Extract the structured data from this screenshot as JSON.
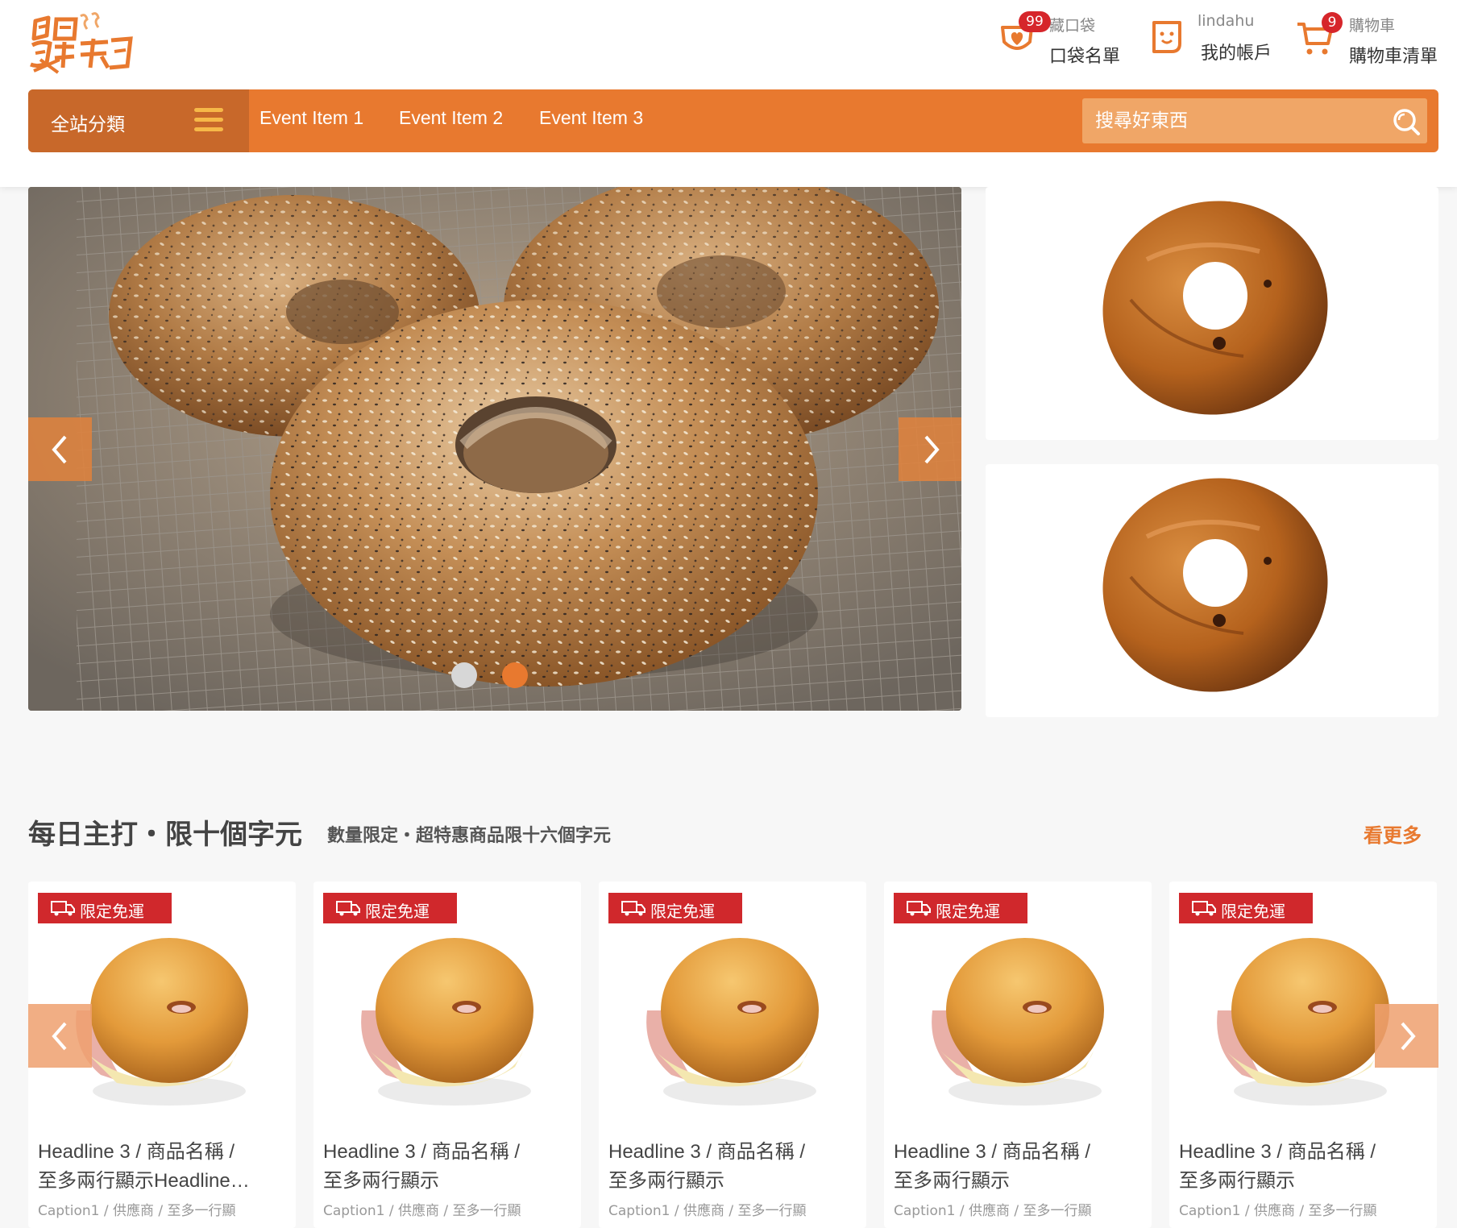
{
  "brand": {
    "logo_text": "食尚玩家"
  },
  "header": {
    "pocket": {
      "count": "99",
      "small_label": "藏口袋",
      "big_label": "口袋名單"
    },
    "account": {
      "username": "lindahu",
      "big_label": "我的帳戶"
    },
    "cart": {
      "count": "9",
      "small_label": "購物車",
      "big_label": "購物車清單"
    }
  },
  "nav": {
    "category_label": "全站分類",
    "events": [
      "Event Item 1",
      "Event Item 2",
      "Event Item 3"
    ],
    "search_placeholder": "搜尋好東西"
  },
  "carousel": {
    "slide_count": 2,
    "active_index": 1
  },
  "daily": {
    "title": "每日主打・限十個字元",
    "subtitle": "數量限定・超特惠商品限十六個字元",
    "see_more": "看更多"
  },
  "products": [
    {
      "badge": "限定免運",
      "name": "Headline 3 / 商品名稱 /\n至多兩行顯示Headline…",
      "caption": "Caption1 / 供應商 / 至多一行顯"
    },
    {
      "badge": "限定免運",
      "name": "Headline 3 / 商品名稱 /\n至多兩行顯示",
      "caption": "Caption1 / 供應商 / 至多一行顯"
    },
    {
      "badge": "限定免運",
      "name": "Headline 3 / 商品名稱 /\n至多兩行顯示",
      "caption": "Caption1 / 供應商 / 至多一行顯"
    },
    {
      "badge": "限定免運",
      "name": "Headline 3 / 商品名稱 /\n至多兩行顯示",
      "caption": "Caption1 / 供應商 / 至多一行顯"
    },
    {
      "badge": "限定免運",
      "name": "Headline 3 / 商品名稱 /\n至多兩行顯示",
      "caption": "Caption1 / 供應商 / 至多一行顯"
    }
  ],
  "colors": {
    "brand_orange": "#e8792f",
    "category_dark": "#c8682a",
    "badge_red": "#d0282c",
    "dot_active": "#e8792f",
    "dot_inactive": "#d7d7d7"
  },
  "icons": [
    "pocket-heart-icon",
    "account-face-icon",
    "shopping-cart-icon",
    "hamburger-icon",
    "search-icon",
    "truck-icon",
    "chevron-left-icon",
    "chevron-right-icon"
  ]
}
